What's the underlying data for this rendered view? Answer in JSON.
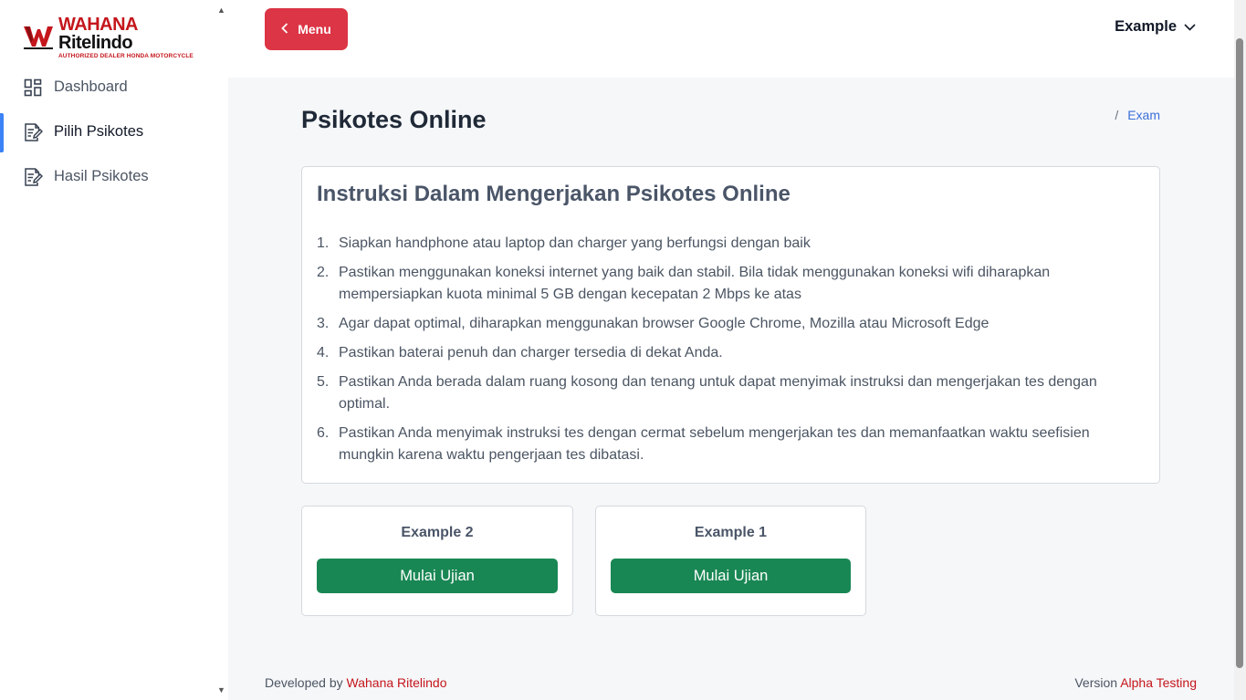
{
  "brand": {
    "title_red": "WAHANA",
    "title_dark": "Ritelindo",
    "subtitle": "AUTHORIZED DEALER HONDA MOTORCYCLE",
    "logo_mark_icon": "wahana-w-logo"
  },
  "sidebar": {
    "items": [
      {
        "label": "Dashboard",
        "icon": "dashboard-grid-icon",
        "active": false
      },
      {
        "label": "Pilih Psikotes",
        "icon": "document-edit-icon",
        "active": true
      },
      {
        "label": "Hasil Psikotes",
        "icon": "document-edit-icon",
        "active": false
      }
    ]
  },
  "topbar": {
    "menu_label": "Menu",
    "user_name": "Example"
  },
  "page": {
    "title": "Psikotes Online",
    "breadcrumb_separator": "/",
    "breadcrumb_current": "Exam"
  },
  "instructions": {
    "title": "Instruksi Dalam Mengerjakan Psikotes Online",
    "items": [
      {
        "num": "1.",
        "text": "Siapkan handphone atau laptop dan charger yang berfungsi dengan baik"
      },
      {
        "num": "2.",
        "text": "Pastikan menggunakan koneksi internet yang baik dan stabil. Bila tidak menggunakan koneksi wifi diharapkan mempersiapkan kuota minimal 5 GB dengan kecepatan 2 Mbps ke atas"
      },
      {
        "num": "3.",
        "text": "Agar dapat optimal, diharapkan menggunakan browser Google Chrome, Mozilla atau Microsoft Edge"
      },
      {
        "num": "4.",
        "text": "Pastikan baterai penuh dan charger tersedia di dekat Anda."
      },
      {
        "num": "5.",
        "text": "Pastikan Anda berada dalam ruang kosong dan tenang untuk dapat menyimak instruksi dan mengerjakan tes dengan optimal."
      },
      {
        "num": "6.",
        "text": "Pastikan Anda menyimak instruksi tes dengan cermat sebelum mengerjakan tes dan memanfaatkan waktu seefisien mungkin karena waktu pengerjaan tes dibatasi."
      }
    ]
  },
  "exams": [
    {
      "name": "Example 2",
      "button": "Mulai Ujian"
    },
    {
      "name": "Example 1",
      "button": "Mulai Ujian"
    }
  ],
  "footer": {
    "developed_prefix": "Developed by",
    "developed_by": "Wahana Ritelindo",
    "version_prefix": "Version",
    "version": "Alpha Testing"
  },
  "colors": {
    "accent_red": "#dc3545",
    "success_green": "#198754",
    "active_indicator": "#3b82f6",
    "brand_red": "#c4161c"
  }
}
